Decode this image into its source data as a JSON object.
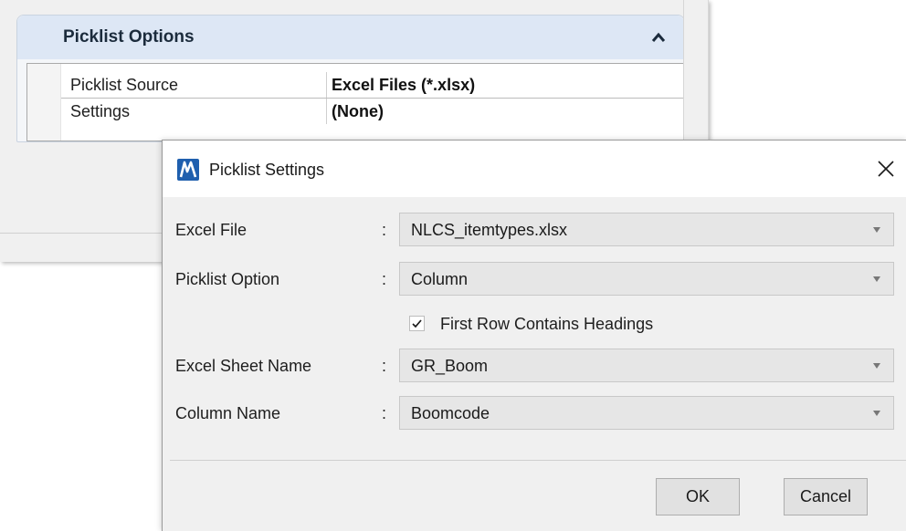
{
  "picklist_panel": {
    "title": "Picklist Options",
    "properties": [
      {
        "name": "Picklist Source",
        "value": "Excel Files (*.xlsx)"
      },
      {
        "name": "Settings",
        "value": "(None)"
      }
    ]
  },
  "dialog": {
    "title": "Picklist Settings",
    "fields": [
      {
        "label": "Excel File",
        "colon": ":",
        "value": "NLCS_itemtypes.xlsx"
      },
      {
        "label": "Picklist Option",
        "colon": ":",
        "value": "Column"
      },
      {
        "label": "Excel Sheet Name",
        "colon": ":",
        "value": "GR_Boom"
      },
      {
        "label": "Column Name",
        "colon": ":",
        "value": "Boomcode"
      }
    ],
    "checkbox": {
      "label": "First Row Contains Headings",
      "checked": true
    },
    "buttons": {
      "ok": "OK",
      "cancel": "Cancel"
    }
  },
  "icons": {
    "collapse": "chevron-up-icon",
    "app": "microstation-app-icon",
    "close": "close-icon",
    "dropdown": "dropdown-arrow-icon",
    "check": "checkmark-icon"
  },
  "colors": {
    "section_header": "#dde7f5",
    "dialog_bg": "#f0f0f0",
    "combo_bg": "#e6e6e6",
    "app_icon_blue": "#1f5fae"
  }
}
